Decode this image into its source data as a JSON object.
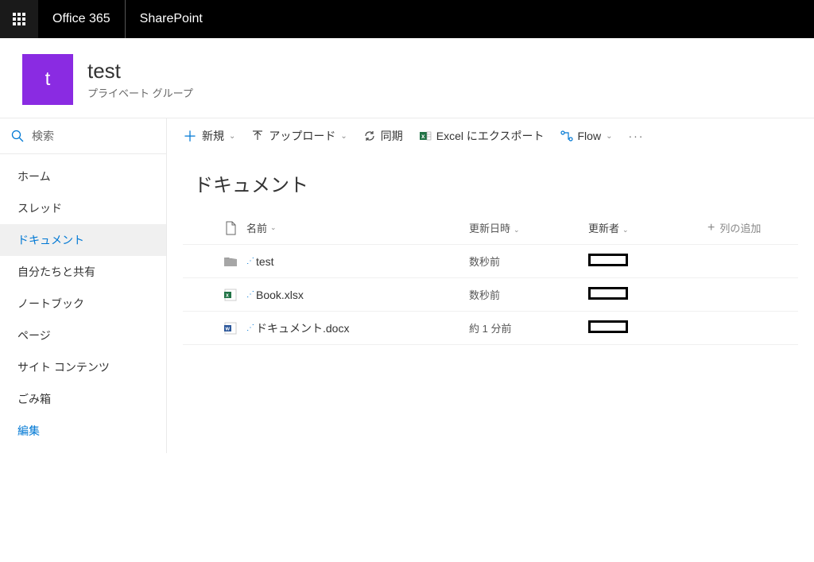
{
  "topbar": {
    "office": "Office 365",
    "app": "SharePoint"
  },
  "site": {
    "logo_letter": "t",
    "title": "test",
    "subtitle": "プライベート グループ"
  },
  "search": {
    "placeholder": "検索"
  },
  "nav": {
    "items": [
      {
        "label": "ホーム"
      },
      {
        "label": "スレッド"
      },
      {
        "label": "ドキュメント",
        "active": true
      },
      {
        "label": "自分たちと共有"
      },
      {
        "label": "ノートブック"
      },
      {
        "label": "ページ"
      },
      {
        "label": "サイト コンテンツ"
      },
      {
        "label": "ごみ箱"
      },
      {
        "label": "編集",
        "link": true
      }
    ]
  },
  "commands": {
    "new": "新規",
    "upload": "アップロード",
    "sync": "同期",
    "excel": "Excel にエクスポート",
    "flow": "Flow"
  },
  "library": {
    "title": "ドキュメント",
    "columns": {
      "name": "名前",
      "modified": "更新日時",
      "by": "更新者",
      "add": "列の追加"
    },
    "rows": [
      {
        "type": "folder",
        "name": "test",
        "modified": "数秒前",
        "new": true
      },
      {
        "type": "xlsx",
        "name": "Book.xlsx",
        "modified": "数秒前",
        "new": true
      },
      {
        "type": "docx",
        "name": "ドキュメント.docx",
        "modified": "約 1 分前",
        "new": true
      }
    ]
  }
}
